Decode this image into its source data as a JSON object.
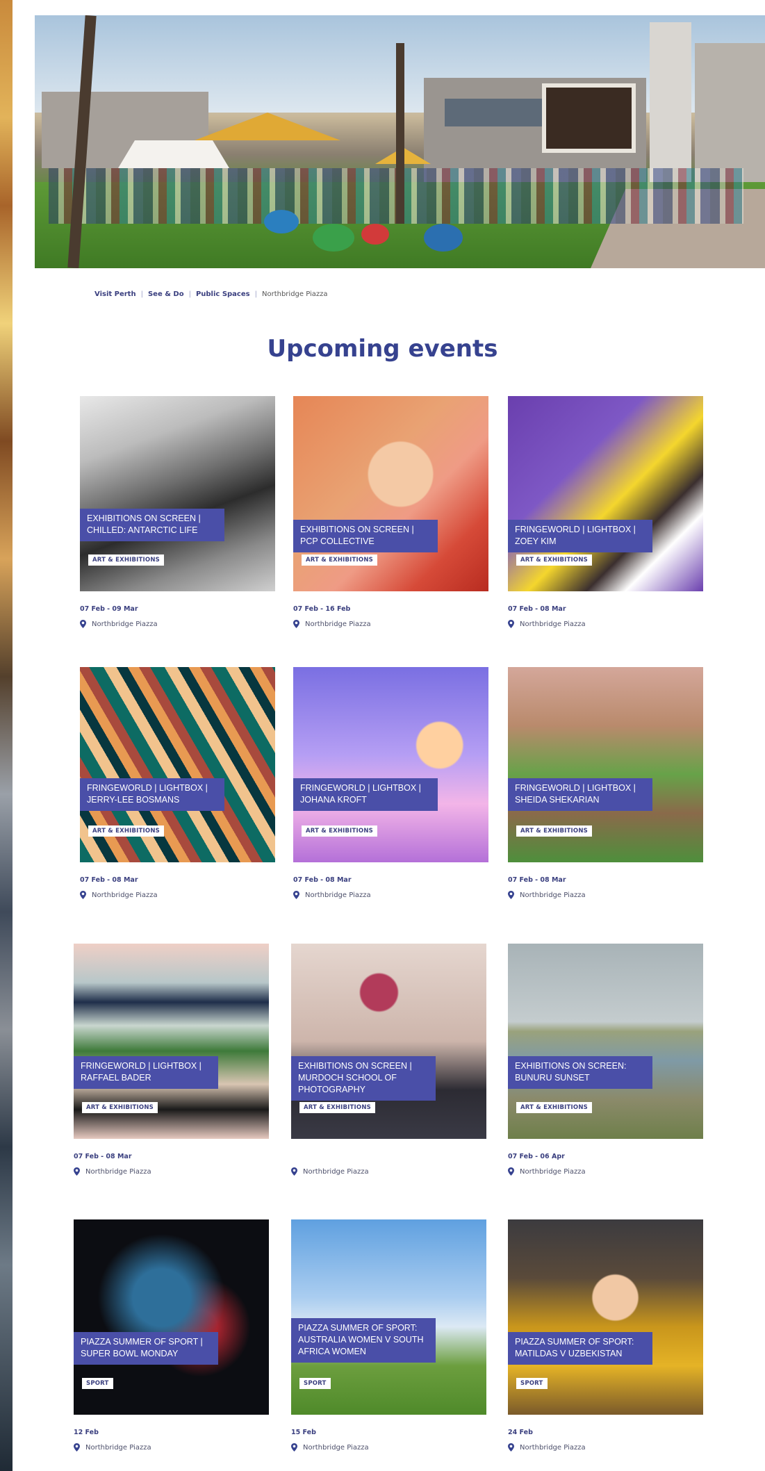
{
  "colors": {
    "brand_navy": "#36428f",
    "label_bg": "#4a4fa8",
    "link": "#3a3f7f"
  },
  "breadcrumb": {
    "items": [
      "Visit Perth",
      "See & Do",
      "Public Spaces"
    ],
    "current": "Northbridge Piazza",
    "separator": "|"
  },
  "section": {
    "title": "Upcoming events"
  },
  "events": [
    {
      "title": "EXHIBITIONS ON SCREEN | CHILLED: ANTARCTIC LIFE",
      "tag": "ART & EXHIBITIONS",
      "date": "07 Feb - 09 Mar",
      "location": "Northbridge Piazza"
    },
    {
      "title": "EXHIBITIONS ON SCREEN | PCP COLLECTIVE",
      "tag": "ART & EXHIBITIONS",
      "date": "07 Feb - 16 Feb",
      "location": "Northbridge Piazza"
    },
    {
      "title": "FRINGEWORLD | LIGHTBOX | ZOEY KIM",
      "tag": "ART & EXHIBITIONS",
      "date": "07 Feb - 08 Mar",
      "location": "Northbridge Piazza"
    },
    {
      "title": "FRINGEWORLD | LIGHTBOX | JERRY-LEE BOSMANS",
      "tag": "ART & EXHIBITIONS",
      "date": "07 Feb - 08 Mar",
      "location": "Northbridge Piazza"
    },
    {
      "title": "FRINGEWORLD | LIGHTBOX | JOHANA KROFT",
      "tag": "ART & EXHIBITIONS",
      "date": "07 Feb - 08 Mar",
      "location": "Northbridge Piazza"
    },
    {
      "title": "FRINGEWORLD | LIGHTBOX | SHEIDA SHEKARIAN",
      "tag": "ART & EXHIBITIONS",
      "date": "07 Feb - 08 Mar",
      "location": "Northbridge Piazza"
    },
    {
      "title": "FRINGEWORLD | LIGHTBOX | RAFFAEL BADER",
      "tag": "ART & EXHIBITIONS",
      "date": "07 Feb - 08 Mar",
      "location": "Northbridge Piazza"
    },
    {
      "title": "EXHIBITIONS ON SCREEN | MURDOCH SCHOOL OF PHOTOGRAPHY",
      "tag": "ART & EXHIBITIONS",
      "date": "",
      "location": "Northbridge Piazza"
    },
    {
      "title": "EXHIBITIONS ON SCREEN: BUNURU SUNSET",
      "tag": "ART & EXHIBITIONS",
      "date": "07 Feb - 06 Apr",
      "location": "Northbridge Piazza"
    },
    {
      "title": "PIAZZA SUMMER OF SPORT | SUPER BOWL MONDAY",
      "tag": "SPORT",
      "date": "12 Feb",
      "location": "Northbridge Piazza"
    },
    {
      "title": "PIAZZA SUMMER OF SPORT: AUSTRALIA WOMEN V SOUTH AFRICA WOMEN",
      "tag": "SPORT",
      "date": "15 Feb",
      "location": "Northbridge Piazza"
    },
    {
      "title": "PIAZZA SUMMER OF SPORT: MATILDAS V UZBEKISTAN",
      "tag": "SPORT",
      "date": "24 Feb",
      "location": "Northbridge Piazza"
    }
  ]
}
